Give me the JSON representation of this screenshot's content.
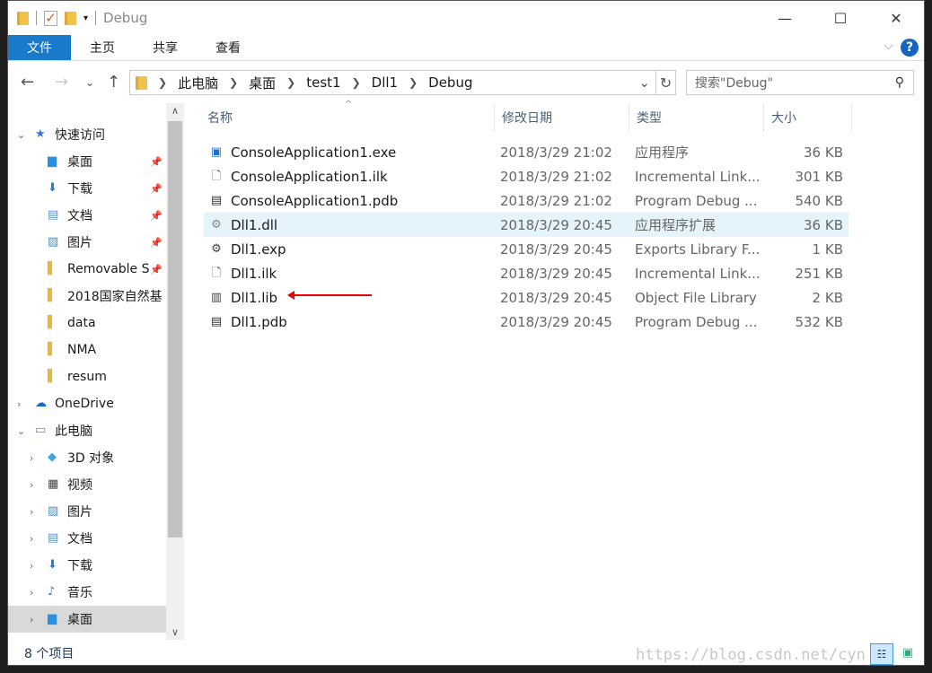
{
  "title": "Debug",
  "ribbon": {
    "tabs": [
      "文件",
      "主页",
      "共享",
      "查看"
    ],
    "help": "?"
  },
  "address": {
    "crumbs": [
      "此电脑",
      "桌面",
      "test1",
      "Dll1",
      "Debug"
    ]
  },
  "search": {
    "placeholder": "搜索\"Debug\""
  },
  "sidebar": {
    "items": [
      {
        "label": "快速访问",
        "icon": "star-icon",
        "level": 0,
        "expanded": true
      },
      {
        "label": "桌面",
        "icon": "desktop-folder-icon",
        "level": 1,
        "pinned": true
      },
      {
        "label": "下载",
        "icon": "download-folder-icon",
        "level": 1,
        "pinned": true
      },
      {
        "label": "文档",
        "icon": "documents-folder-icon",
        "level": 1,
        "pinned": true
      },
      {
        "label": "图片",
        "icon": "pictures-folder-icon",
        "level": 1,
        "pinned": true
      },
      {
        "label": "Removable S",
        "icon": "folder-icon",
        "level": 1,
        "pinned": true
      },
      {
        "label": "2018国家自然基",
        "icon": "folder-icon",
        "level": 1
      },
      {
        "label": "data",
        "icon": "folder-icon",
        "level": 1
      },
      {
        "label": "NMA",
        "icon": "folder-icon",
        "level": 1
      },
      {
        "label": "resum",
        "icon": "folder-icon",
        "level": 1
      },
      {
        "label": "OneDrive",
        "icon": "cloud-icon",
        "level": 0,
        "expanded": false
      },
      {
        "label": "此电脑",
        "icon": "computer-icon",
        "level": 0,
        "expanded": true
      },
      {
        "label": "3D 对象",
        "icon": "3d-objects-icon",
        "level": 1
      },
      {
        "label": "视频",
        "icon": "videos-icon",
        "level": 1
      },
      {
        "label": "图片",
        "icon": "pictures-folder-icon",
        "level": 1
      },
      {
        "label": "文档",
        "icon": "documents-folder-icon",
        "level": 1
      },
      {
        "label": "下载",
        "icon": "download-folder-icon",
        "level": 1
      },
      {
        "label": "音乐",
        "icon": "music-icon",
        "level": 1
      },
      {
        "label": "桌面",
        "icon": "desktop-folder-icon",
        "level": 1,
        "selected": true
      }
    ]
  },
  "columns": {
    "name": "名称",
    "date": "修改日期",
    "type": "类型",
    "size": "大小"
  },
  "files": [
    {
      "name": "ConsoleApplication1.exe",
      "date": "2018/3/29 21:02",
      "type": "应用程序",
      "size": "36 KB",
      "icon": "exe-icon"
    },
    {
      "name": "ConsoleApplication1.ilk",
      "date": "2018/3/29 21:02",
      "type": "Incremental Link...",
      "size": "301 KB",
      "icon": "ilk-file-icon"
    },
    {
      "name": "ConsoleApplication1.pdb",
      "date": "2018/3/29 21:02",
      "type": "Program Debug ...",
      "size": "540 KB",
      "icon": "pdb-file-icon"
    },
    {
      "name": "Dll1.dll",
      "date": "2018/3/29 20:45",
      "type": "应用程序扩展",
      "size": "36 KB",
      "icon": "dll-file-icon",
      "selected": true
    },
    {
      "name": "Dll1.exp",
      "date": "2018/3/29 20:45",
      "type": "Exports Library F...",
      "size": "1 KB",
      "icon": "exp-file-icon"
    },
    {
      "name": "Dll1.ilk",
      "date": "2018/3/29 20:45",
      "type": "Incremental Link...",
      "size": "251 KB",
      "icon": "ilk-file-icon"
    },
    {
      "name": "Dll1.lib",
      "date": "2018/3/29 20:45",
      "type": "Object File Library",
      "size": "2 KB",
      "icon": "lib-file-icon"
    },
    {
      "name": "Dll1.pdb",
      "date": "2018/3/29 20:45",
      "type": "Program Debug ...",
      "size": "532 KB",
      "icon": "pdb-file-icon"
    }
  ],
  "status": {
    "count": "8 个项目"
  },
  "watermark": "https://blog.csdn.net/cyn",
  "colors": {
    "accent": "#1979ca",
    "selection": "#e5f3fb",
    "annotation_arrow": "#e00000"
  }
}
